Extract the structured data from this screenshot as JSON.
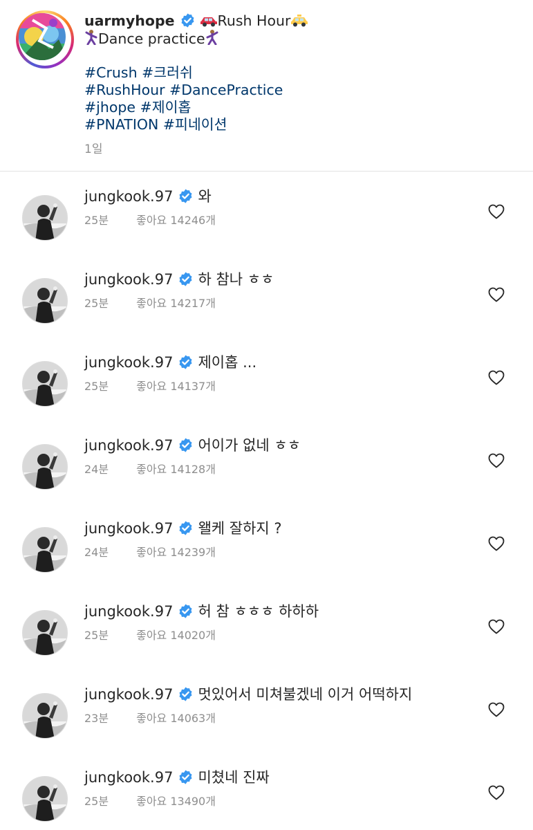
{
  "caption": {
    "username": "uarmyhope",
    "line1_text": "Rush Hour",
    "line2_text": "Dance practice",
    "hashtag_lines": [
      "#Crush #크러쉬",
      "#RushHour #DancePractice",
      "#jhope #제이홉",
      "#PNATION #피네이션"
    ],
    "time": "1일",
    "icons": {
      "left_emoji_1": "red-car-emoji",
      "right_emoji_1": "taxi-emoji",
      "emoji_2": "dancing-man-emoji"
    }
  },
  "comments": [
    {
      "username": "jungkook.97",
      "text": "와",
      "time": "25분",
      "likes": "좋아요 14246개"
    },
    {
      "username": "jungkook.97",
      "text": "하 참나 ㅎㅎ",
      "time": "25분",
      "likes": "좋아요 14217개"
    },
    {
      "username": "jungkook.97",
      "text": "제이홉 ...",
      "time": "25분",
      "likes": "좋아요 14137개"
    },
    {
      "username": "jungkook.97",
      "text": "어이가 없네 ㅎㅎ",
      "time": "24분",
      "likes": "좋아요 14128개"
    },
    {
      "username": "jungkook.97",
      "text": "왤케 잘하지 ?",
      "time": "24분",
      "likes": "좋아요 14239개"
    },
    {
      "username": "jungkook.97",
      "text": "허 참 ㅎㅎㅎ 하하하",
      "time": "25분",
      "likes": "좋아요 14020개"
    },
    {
      "username": "jungkook.97",
      "text": "멋있어서 미쳐불겠네 이거 어떡하지",
      "time": "23분",
      "likes": "좋아요 14063개"
    },
    {
      "username": "jungkook.97",
      "text": "미쳤네 진짜",
      "time": "25분",
      "likes": "좋아요 13490개"
    }
  ],
  "colors": {
    "verified": "#3897f0",
    "hashtag": "#00376b",
    "meta": "#8e8e8e",
    "divider": "#e3e3e3"
  }
}
